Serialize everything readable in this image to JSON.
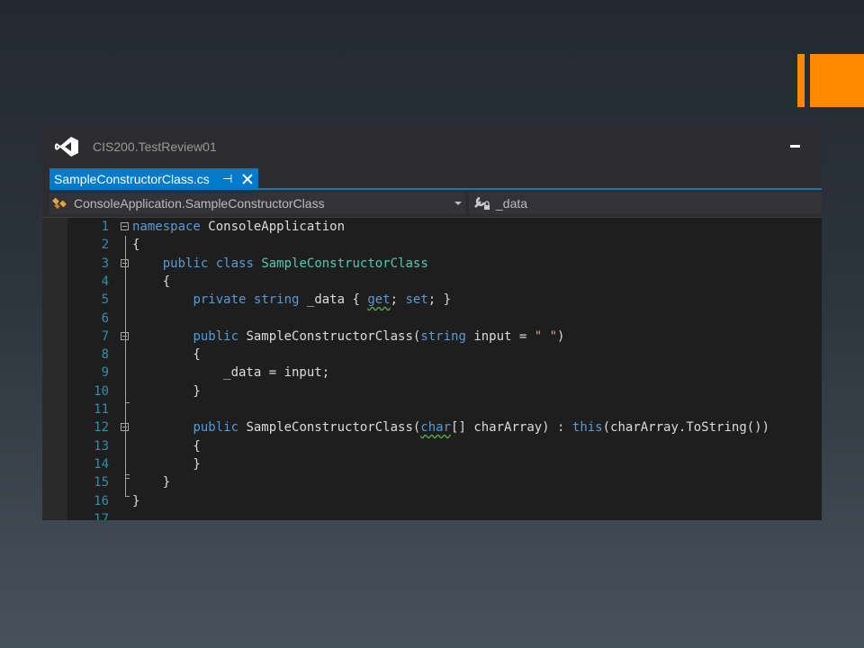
{
  "window": {
    "title": "CIS200.TestReview01"
  },
  "tab": {
    "filename": "SampleConstructorClass.cs",
    "pin_glyph": "⊣"
  },
  "navbar": {
    "type_dropdown": "ConsoleApplication.SampleConstructorClass",
    "member_dropdown": "_data"
  },
  "editor": {
    "line_numbers": [
      "1",
      "2",
      "3",
      "4",
      "5",
      "6",
      "7",
      "8",
      "9",
      "10",
      "11",
      "12",
      "13",
      "14",
      "15",
      "16",
      "17"
    ],
    "lines": [
      [
        {
          "t": "namespace",
          "c": "kw"
        },
        {
          "t": " ConsoleApplication"
        }
      ],
      [
        {
          "t": "{"
        }
      ],
      [
        {
          "t": "    "
        },
        {
          "t": "public",
          "c": "kw"
        },
        {
          "t": " "
        },
        {
          "t": "class",
          "c": "kw"
        },
        {
          "t": " "
        },
        {
          "t": "SampleConstructorClass",
          "c": "ty"
        }
      ],
      [
        {
          "t": "    {"
        }
      ],
      [
        {
          "t": "        "
        },
        {
          "t": "private",
          "c": "kw"
        },
        {
          "t": " "
        },
        {
          "t": "string",
          "c": "kw"
        },
        {
          "t": " _data { "
        },
        {
          "t": "get",
          "c": "kw sq"
        },
        {
          "t": "; "
        },
        {
          "t": "set",
          "c": "kw"
        },
        {
          "t": "; }"
        }
      ],
      [],
      [
        {
          "t": "        "
        },
        {
          "t": "public",
          "c": "kw"
        },
        {
          "t": " SampleConstructorClass("
        },
        {
          "t": "string",
          "c": "kw"
        },
        {
          "t": " input = "
        },
        {
          "t": "\" \"",
          "c": "st"
        },
        {
          "t": ")"
        }
      ],
      [
        {
          "t": "        {"
        }
      ],
      [
        {
          "t": "            _data = input;"
        }
      ],
      [
        {
          "t": "        }"
        }
      ],
      [],
      [
        {
          "t": "        "
        },
        {
          "t": "public",
          "c": "kw"
        },
        {
          "t": " SampleConstructorClass("
        },
        {
          "t": "char",
          "c": "kw sq"
        },
        {
          "t": "[] charArray) : "
        },
        {
          "t": "this",
          "c": "kw"
        },
        {
          "t": "(charArray.ToString())"
        }
      ],
      [
        {
          "t": "        {"
        }
      ],
      [
        {
          "t": "        }"
        }
      ],
      [
        {
          "t": "    }"
        }
      ],
      [
        {
          "t": "}"
        }
      ],
      []
    ]
  },
  "icons": {
    "app": "visual-studio-logo-icon",
    "type": "class-icon",
    "member": "property-icon"
  },
  "colors": {
    "accent": "#ff8a00",
    "tab_active": "#007acc",
    "keyword": "#569cd6",
    "type": "#4ec9b0",
    "string": "#d69d85",
    "line_number": "#2b91af"
  }
}
